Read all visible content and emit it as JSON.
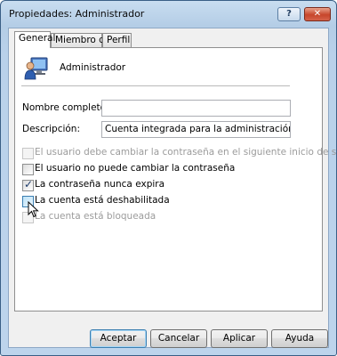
{
  "window": {
    "title": "Propiedades: Administrador",
    "help_label": "?",
    "close_label": "✕"
  },
  "tabs": [
    {
      "label": "General",
      "active": true
    },
    {
      "label": "Miembro de",
      "active": false
    },
    {
      "label": "Perfil",
      "active": false
    }
  ],
  "general": {
    "user_name": "Administrador",
    "fullname_label": "Nombre completo:",
    "fullname_value": "",
    "description_label": "Descripción:",
    "description_value": "Cuenta integrada para la administración del equipo"
  },
  "checkboxes": [
    {
      "label": "El usuario debe cambiar la contraseña en el siguiente inicio de sesión",
      "checked": false,
      "enabled": false
    },
    {
      "label": "El usuario no puede cambiar la contraseña",
      "checked": false,
      "enabled": true
    },
    {
      "label": "La contraseña nunca expira",
      "checked": true,
      "enabled": true
    },
    {
      "label": "La cuenta está deshabilitada",
      "checked": false,
      "enabled": true
    },
    {
      "label": "La cuenta está bloqueada",
      "checked": false,
      "enabled": false
    }
  ],
  "buttons": {
    "ok": "Aceptar",
    "cancel": "Cancelar",
    "apply": "Aplicar",
    "help": "Ayuda"
  },
  "icons": {
    "user": "user-monitor-icon",
    "cursor": "mouse-pointer-icon"
  },
  "colors": {
    "titlebar": "#b4cde6",
    "close": "#c7452b",
    "focus": "#3c7fb1"
  }
}
